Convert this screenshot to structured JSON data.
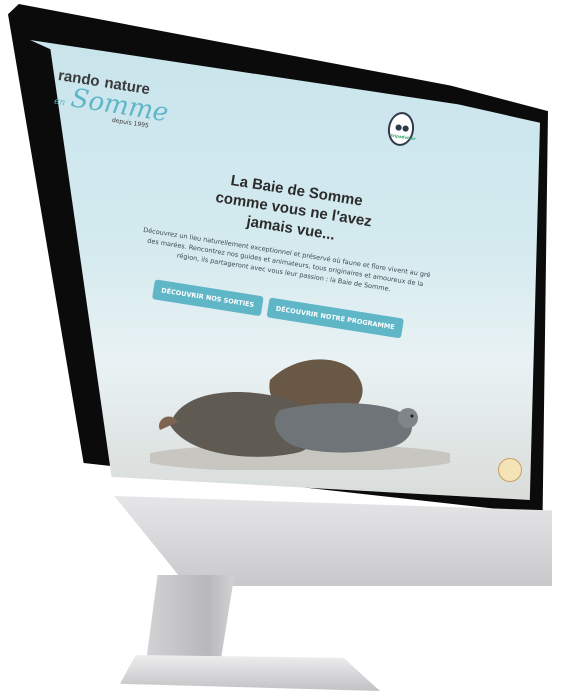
{
  "site": {
    "logo": {
      "line1": "rando",
      "line2": "nature",
      "en": "en",
      "somme": "Somme",
      "since": "depuis 1995"
    },
    "badge_icon": "tripadvisor-owl-icon",
    "badge_label": "tripadvisor"
  },
  "hero": {
    "title_line1": "La Baie de Somme",
    "title_line2": "comme vous ne l'avez",
    "title_line3": "jamais vue...",
    "text": "Découvrez un lieu naturellement exceptionnel et préservé où faune et flore vivent au gré des marées. Rencontrez nos guides et animateurs, tous originaires et amoureux de la région, ils partageront avec vous leur passion : la Baie de Somme.",
    "buttons": {
      "sorties": "DÉCOUVRIR NOS SORTIES",
      "programme": "DÉCOUVRIR NOTRE PROGRAMME"
    }
  },
  "colors": {
    "accent": "#5fb6c7",
    "text": "#2c2c2c",
    "sky": "#c9e4ec"
  }
}
